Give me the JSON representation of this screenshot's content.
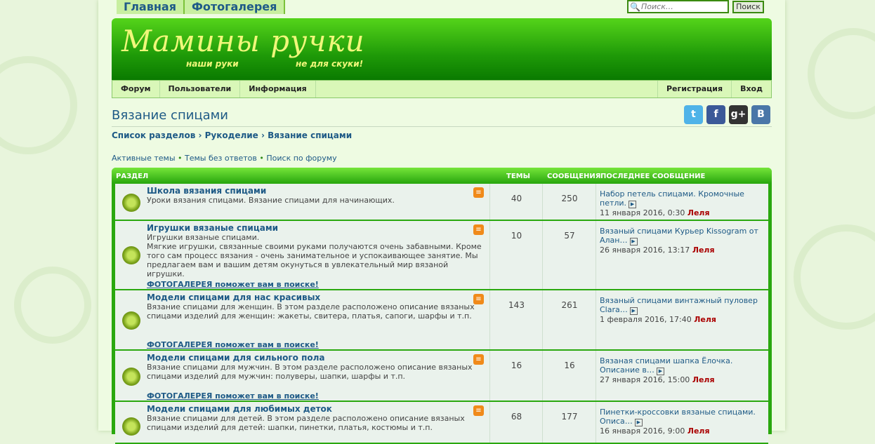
{
  "topnav": {
    "home": "Главная",
    "gallery": "Фотогалерея"
  },
  "search": {
    "placeholder": "Поиск…",
    "button": "Поиск"
  },
  "logo": {
    "title": "Мамины ручки",
    "tagline1": "наши руки",
    "tagline2": "не для скуки!"
  },
  "navbar": {
    "forum": "Форум",
    "users": "Пользователи",
    "info": "Информация",
    "register": "Регистрация",
    "login": "Вход"
  },
  "page": {
    "title": "Вязание спицами"
  },
  "breadcrumb": {
    "item1": "Список разделов",
    "sep1": "›",
    "item2": "Рукоделие",
    "sep2": "›",
    "item3": "Вязание спицами"
  },
  "quicklinks": {
    "active": "Активные темы",
    "unanswered": "Темы без ответов",
    "search": "Поиск по форуму",
    "sep": "•"
  },
  "social": {
    "twitter": "t",
    "facebook": "f",
    "gplus": "g+",
    "vk": "B"
  },
  "table": {
    "head_section": "Раздел",
    "head_topics": "Темы",
    "head_posts": "Сообщения",
    "head_last": "Последнее сообщение"
  },
  "forums": [
    {
      "title": "Школа вязания спицами",
      "desc": "Уроки вязания спицами. Вязание спицами для начинающих.",
      "gallery": "",
      "topics": "40",
      "posts": "250",
      "last_title": "Набор петель спицами. Кромочные петли.",
      "last_date": "11 января 2016, 0:30",
      "last_author": "Леля"
    },
    {
      "title": "Игрушки вязаные спицами",
      "desc": "Игрушки вязаные спицами.\nМягкие игрушки, связанные своими руками получаются очень забавными. Кроме того сам процесс вязания - очень занимательное и успокаивающее занятие. Мы предлагаем вам и вашим детям окунуться в увлекательный мир вязаной игрушки.",
      "gallery": "ФОТОГАЛЕРЕЯ поможет вам в поиске!",
      "topics": "10",
      "posts": "57",
      "last_title": "Вязаный спицами Курьер Kissogram от Алан…",
      "last_date": "26 января 2016, 13:17",
      "last_author": "Леля"
    },
    {
      "title": "Модели спицами для нас красивых",
      "desc": "Вязание спицами для женщин. В этом разделе расположено описание вязаных спицами изделий для женщин: жакеты, свитера, платья, сапоги, шарфы и т.п.",
      "gallery": "ФОТОГАЛЕРЕЯ поможет вам в поиске!",
      "topics": "143",
      "posts": "261",
      "last_title": "Вязаный спицами винтажный пуловер Clara…",
      "last_date": "1 февраля 2016, 17:40",
      "last_author": "Леля"
    },
    {
      "title": "Модели спицами для сильного пола",
      "desc": "Вязание спицами для мужчин. В этом разделе расположено описание вязаных спицами изделий для мужчин: полуверы, шапки, шарфы и т.п.",
      "gallery": "ФОТОГАЛЕРЕЯ поможет вам в поиске!",
      "topics": "16",
      "posts": "16",
      "last_title": "Вязаная спицами шапка Ёлочка. Описание в…",
      "last_date": "27 января 2016, 15:00",
      "last_author": "Леля"
    },
    {
      "title": "Модели спицами для любимых деток",
      "desc": "Вязание спицами для детей. В этом разделе расположено описание вязаных спицами изделий для детей: шапки, пинетки, платья, костюмы и т.п.",
      "gallery": "",
      "topics": "68",
      "posts": "177",
      "last_title": "Пинетки-кроссовки вязаные спицами. Описа…",
      "last_date": "16 января 2016, 9:00",
      "last_author": "Леля"
    }
  ]
}
